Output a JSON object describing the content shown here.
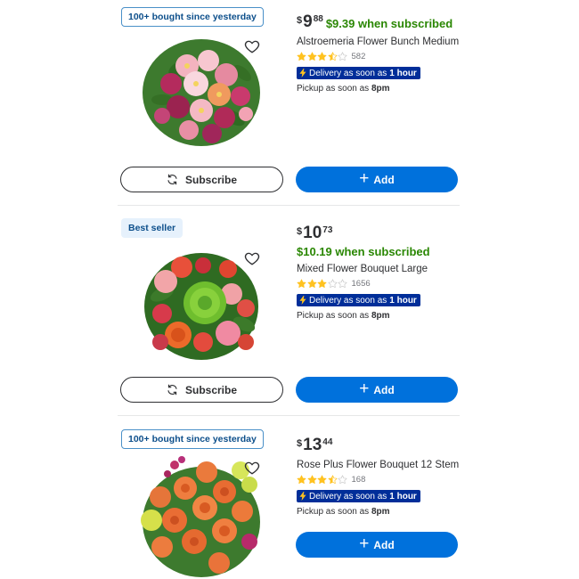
{
  "products": [
    {
      "badge": "100+ bought since yesterday",
      "badge_style": "outline",
      "currency": "$",
      "dollars": "9",
      "cents": "88",
      "subscribe_price": "$9.39 when subscribed",
      "name": "Alstroemeria Flower Bunch Medium",
      "rating": 3.5,
      "review_count": "582",
      "delivery_prefix": "Delivery as soon as",
      "delivery_time": "1 hour",
      "pickup_prefix": "Pickup as soon as",
      "pickup_time": "8pm",
      "subscribe_label": "Subscribe",
      "add_label": "Add",
      "flower_palette": "alstroemeria"
    },
    {
      "badge": "Best seller",
      "badge_style": "filled",
      "currency": "$",
      "dollars": "10",
      "cents": "73",
      "subscribe_price": "$10.19 when subscribed",
      "name": "Mixed Flower Bouquet Large",
      "rating": 3,
      "review_count": "1656",
      "delivery_prefix": "Delivery as soon as",
      "delivery_time": "1 hour",
      "pickup_prefix": "Pickup as soon as",
      "pickup_time": "8pm",
      "subscribe_label": "Subscribe",
      "add_label": "Add",
      "flower_palette": "mixed"
    },
    {
      "badge": "100+ bought since yesterday",
      "badge_style": "outline",
      "currency": "$",
      "dollars": "13",
      "cents": "44",
      "name": "Rose Plus Flower Bouquet 12 Stem",
      "rating": 3.5,
      "review_count": "168",
      "delivery_prefix": "Delivery as soon as",
      "delivery_time": "1 hour",
      "pickup_prefix": "Pickup as soon as",
      "pickup_time": "8pm",
      "add_label": "Add",
      "flower_palette": "roses"
    }
  ],
  "colors": {
    "accent_blue": "#0071dc",
    "delivery_navy": "#002e99",
    "subscribe_green": "#2a8703",
    "star_gold": "#ffc220",
    "badge_blue": "#0d4f8b"
  },
  "icons": {
    "favorite": "heart-outline-icon",
    "subscribe": "sync-icon",
    "add": "plus-icon",
    "delivery": "lightning-bolt-icon",
    "rating": "star-icon"
  }
}
